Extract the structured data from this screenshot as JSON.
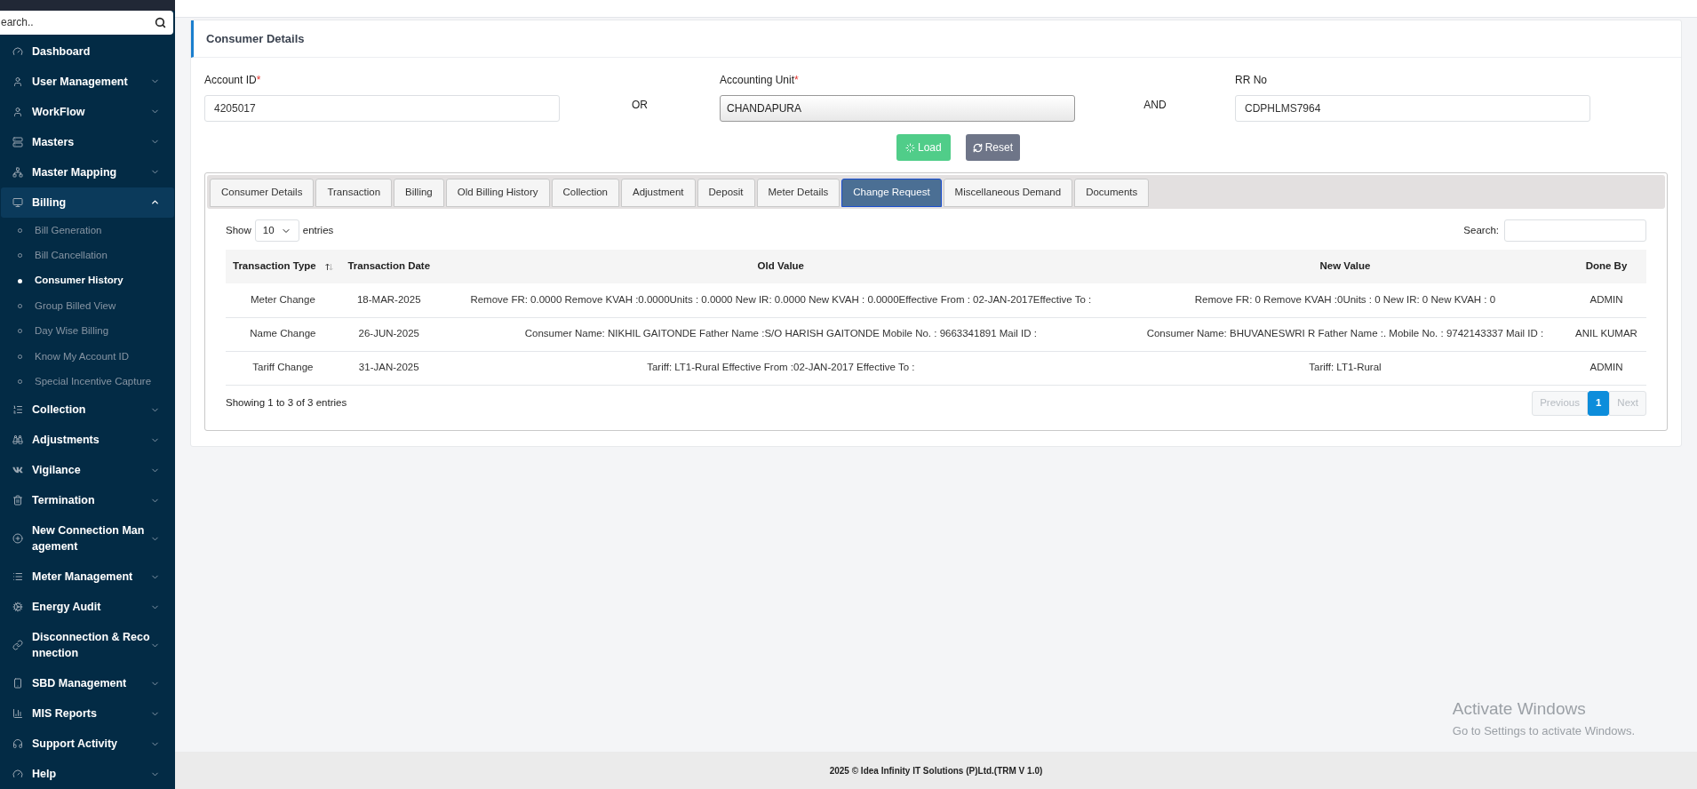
{
  "sidebar": {
    "search": {
      "placeholder": "earch.."
    },
    "items": [
      {
        "label": "Dashboard",
        "expandable": false,
        "expanded": false
      },
      {
        "label": "User Management",
        "expandable": true,
        "expanded": false
      },
      {
        "label": "WorkFlow",
        "expandable": true,
        "expanded": false
      },
      {
        "label": "Masters",
        "expandable": true,
        "expanded": false
      },
      {
        "label": "Master Mapping",
        "expandable": true,
        "expanded": false
      },
      {
        "label": "Billing",
        "expandable": true,
        "expanded": true,
        "children": [
          {
            "label": "Bill Generation",
            "selected": false
          },
          {
            "label": "Bill Cancellation",
            "selected": false
          },
          {
            "label": "Consumer History",
            "selected": true
          },
          {
            "label": "Group Billed View",
            "selected": false
          },
          {
            "label": "Day Wise Billing",
            "selected": false
          },
          {
            "label": "Know My Account ID",
            "selected": false
          },
          {
            "label": "Special Incentive Capture",
            "selected": false
          }
        ]
      },
      {
        "label": "Collection",
        "expandable": true,
        "expanded": false
      },
      {
        "label": "Adjustments",
        "expandable": true,
        "expanded": false
      },
      {
        "label": "Vigilance",
        "expandable": true,
        "expanded": false
      },
      {
        "label": "Termination",
        "expandable": true,
        "expanded": false
      },
      {
        "label": "New Connection Management",
        "expandable": true,
        "expanded": false
      },
      {
        "label": "Meter Management",
        "expandable": true,
        "expanded": false
      },
      {
        "label": "Energy Audit",
        "expandable": true,
        "expanded": false
      },
      {
        "label": "Disconnection & Reconnection",
        "expandable": true,
        "expanded": false
      },
      {
        "label": "SBD Management",
        "expandable": true,
        "expanded": false
      },
      {
        "label": "MIS Reports",
        "expandable": true,
        "expanded": false
      },
      {
        "label": "Support Activity",
        "expandable": true,
        "expanded": false
      },
      {
        "label": "Help",
        "expandable": true,
        "expanded": false
      }
    ]
  },
  "card": {
    "title": "Consumer Details",
    "fields": [
      {
        "kind": "input",
        "label": "Account ID",
        "required_mark": "*",
        "value": "4205017"
      },
      {
        "kind": "connector",
        "text": "OR"
      },
      {
        "kind": "select",
        "label": "Accounting Unit",
        "required_mark": "*",
        "value": "CHANDAPURA"
      },
      {
        "kind": "connector",
        "text": "AND"
      },
      {
        "kind": "input",
        "label": "RR No",
        "value": "CDPHLMS7964"
      }
    ],
    "buttons": [
      {
        "kind": "load",
        "label": "Load"
      },
      {
        "kind": "reset",
        "label": "Reset"
      }
    ],
    "tabs": [
      {
        "label": "Consumer Details",
        "selected": false
      },
      {
        "label": "Transaction",
        "selected": false
      },
      {
        "label": "Billing",
        "selected": false
      },
      {
        "label": "Old Billing History",
        "selected": false
      },
      {
        "label": "Collection",
        "selected": false
      },
      {
        "label": "Adjustment",
        "selected": false
      },
      {
        "label": "Deposit",
        "selected": false
      },
      {
        "label": "Meter Details",
        "selected": false
      },
      {
        "label": "Change Request",
        "selected": true
      },
      {
        "label": "Miscellaneous Demand",
        "selected": false
      },
      {
        "label": "Documents",
        "selected": false
      }
    ],
    "table": {
      "show_label": "Show",
      "page_size": "10",
      "entries_label": "entries",
      "search_label": "Search:",
      "columns": [
        {
          "label": "Transaction Type",
          "sortable": true
        },
        {
          "label": "Transaction Date",
          "sortable": false
        },
        {
          "label": "Old Value",
          "sortable": false
        },
        {
          "label": "New Value",
          "sortable": false
        },
        {
          "label": "Done By",
          "sortable": false
        }
      ],
      "rows": [
        [
          "Meter Change",
          "18-MAR-2025",
          "Remove FR: 0.0000 Remove KVAH :0.0000Units : 0.0000 New IR: 0.0000 New KVAH : 0.0000Effective From : 02-JAN-2017Effective To :",
          "Remove FR: 0 Remove KVAH :0Units : 0 New IR: 0 New KVAH : 0",
          "ADMIN"
        ],
        [
          "Name Change",
          "26-JUN-2025",
          "Consumer Name: NIKHIL GAITONDE Father Name :S/O HARISH GAITONDE Mobile No. : 9663341891 Mail ID :",
          "Consumer Name: BHUVANESWRI R Father Name :. Mobile No. : 9742143337 Mail ID :",
          "ANIL KUMAR"
        ],
        [
          "Tariff Change",
          "31-JAN-2025",
          "Tariff: LT1-Rural Effective From :02-JAN-2017 Effective To :",
          "Tariff: LT1-Rural",
          "ADMIN"
        ]
      ],
      "info": "Showing 1 to 3 of 3 entries",
      "pagination": [
        {
          "kind": "prev",
          "label": "Previous",
          "disabled": true,
          "selected": false
        },
        {
          "kind": "page",
          "label": "1",
          "disabled": false,
          "selected": true
        },
        {
          "kind": "next",
          "label": "Next",
          "disabled": true,
          "selected": false
        }
      ]
    }
  },
  "os_overlay": {
    "title": "Activate Windows",
    "subtitle": "Go to Settings to activate Windows."
  },
  "footer": "2025 © Idea Infinity IT Solutions (P)Ltd.(TRM V 1.0)"
}
